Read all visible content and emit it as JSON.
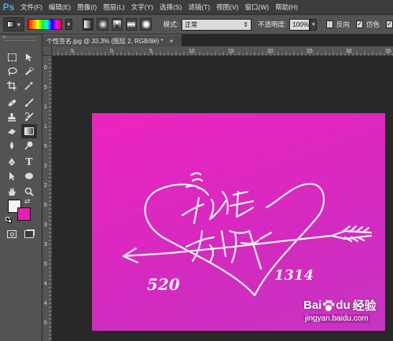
{
  "app": {
    "logo": "Ps"
  },
  "menu": {
    "items": [
      "文件(F)",
      "编辑(E)",
      "图像(I)",
      "图层(L)",
      "文字(Y)",
      "选择(S)",
      "滤镜(T)",
      "视图(V)",
      "窗口(W)",
      "帮助(H)"
    ]
  },
  "options": {
    "preset_arrow": "▾",
    "mode_label": "模式:",
    "mode_value": "正常",
    "opacity_label": "不透明度:",
    "opacity_value": "100%",
    "reverse_label": "反向",
    "dither_label": "仿色",
    "dither_checked": "✓"
  },
  "document": {
    "tab_title": "个性签名.jpg @ 33.3% (图层 2, RGB/8#) *",
    "close": "×"
  },
  "rulers": {
    "h_ticks": [
      "5",
      "0",
      "5",
      "10",
      "15",
      "20",
      "25",
      "30",
      "35"
    ],
    "v_ticks": [
      "0",
      "5",
      "1",
      "1",
      "5",
      "2",
      "2",
      "5",
      "3",
      "3",
      "5",
      "4",
      "4",
      "5"
    ]
  },
  "artwork": {
    "number_left": "520",
    "number_right": "1314"
  },
  "colors": {
    "foreground": "#f2f2f2",
    "background": "#e51fb6",
    "canvas_pink": "#e526be"
  },
  "watermark": {
    "brand_a": "Bai",
    "brand_b": "du",
    "brand_cn": "经验",
    "url": "jingyan.baidu.com"
  }
}
